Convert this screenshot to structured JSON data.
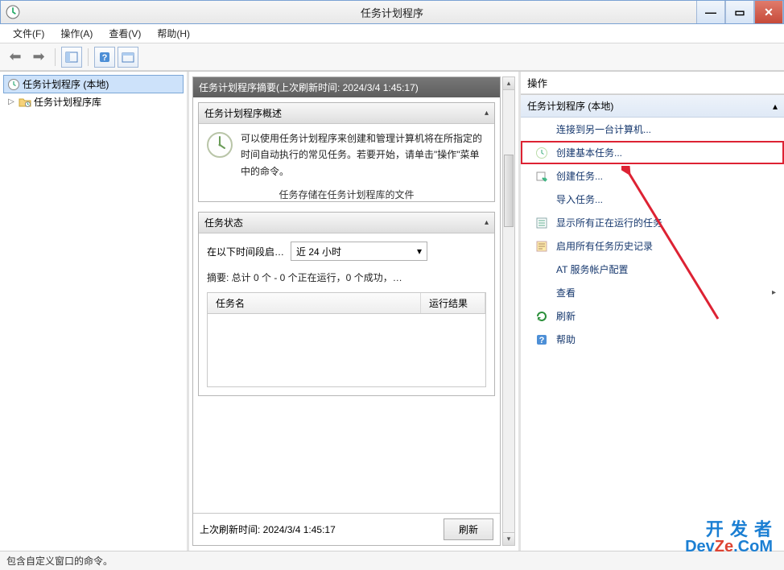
{
  "app_title": "任务计划程序",
  "menu": {
    "file": "文件(F)",
    "action": "操作(A)",
    "view": "查看(V)",
    "help": "帮助(H)"
  },
  "tree": {
    "root": "任务计划程序 (本地)",
    "child": "任务计划程序库"
  },
  "center": {
    "header": "任务计划程序摘要(上次刷新时间: 2024/3/4 1:45:17)",
    "overview_title": "任务计划程序概述",
    "overview_text": "可以使用任务计划程序来创建和管理计算机将在所指定的时间自动执行的常见任务。若要开始，请单击\"操作\"菜单中的命令。",
    "overview_truncated": "任务存储在任务计划程库的文件",
    "status_title": "任务状态",
    "filter_label": "在以下时间段启…",
    "filter_value": "近 24 小时",
    "summary": "摘要: 总计 0 个 - 0 个正在运行，0 个成功，…",
    "col_taskname": "任务名",
    "col_result": "运行结果",
    "footer_time_label": "上次刷新时间: 2024/3/4 1:45:17",
    "refresh_btn": "刷新"
  },
  "actions": {
    "pane_title": "操作",
    "subhead": "任务计划程序 (本地)",
    "items": [
      {
        "label": "连接到另一台计算机...",
        "icon": "blank"
      },
      {
        "label": "创建基本任务...",
        "icon": "clock",
        "highlight": true
      },
      {
        "label": "创建任务...",
        "icon": "run"
      },
      {
        "label": "导入任务...",
        "icon": "blank"
      },
      {
        "label": "显示所有正在运行的任务",
        "icon": "list"
      },
      {
        "label": "启用所有任务历史记录",
        "icon": "history"
      },
      {
        "label": "AT 服务帐户配置",
        "icon": "blank"
      },
      {
        "label": "查看",
        "icon": "blank",
        "submenu": true
      },
      {
        "label": "刷新",
        "icon": "refresh"
      },
      {
        "label": "帮助",
        "icon": "help"
      }
    ]
  },
  "statusbar": "包含自定义窗口的命令。",
  "watermark": {
    "line1": "开 发 者",
    "line2_a": "Dev",
    "line2_b": "Ze",
    "line2_c": ".CoM"
  }
}
